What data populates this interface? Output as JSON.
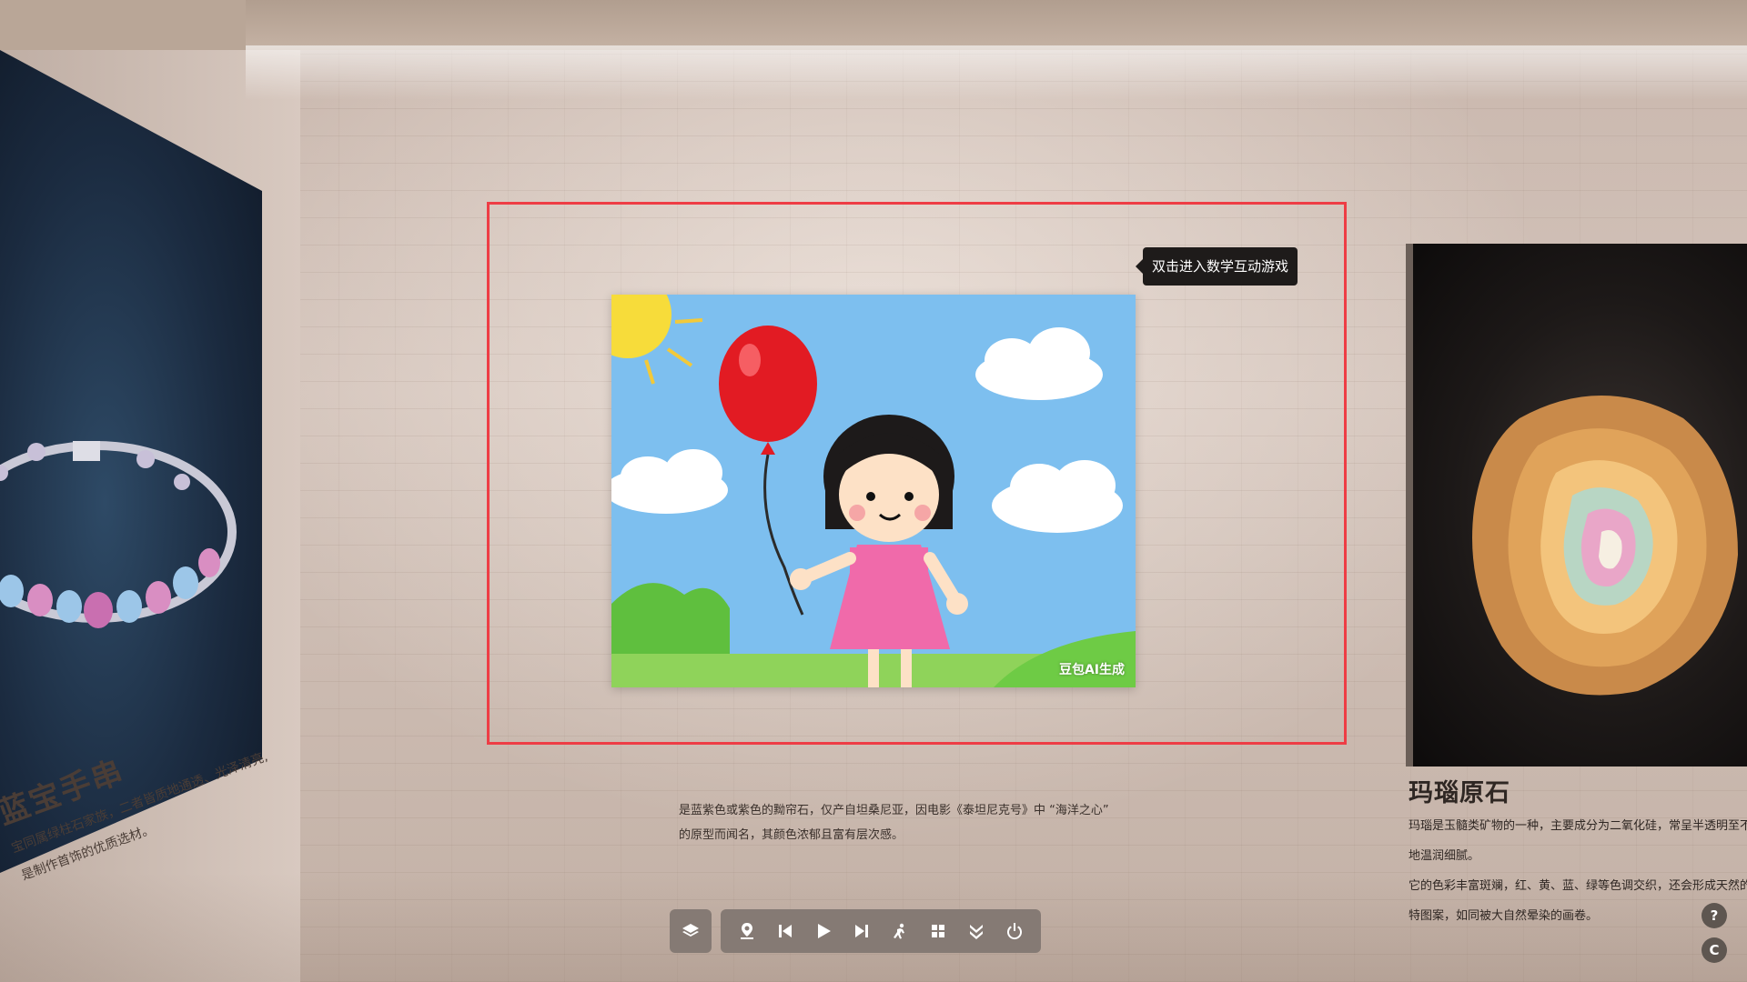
{
  "left_exhibit": {
    "title": "蓝宝手串",
    "desc_lines": [
      "宝同属绿柱石家族，二者皆质地通透、光泽清亮,",
      "是制作首饰的优质选材。"
    ]
  },
  "center_exhibit": {
    "tooltip": "双击进入数学互动游戏",
    "watermark": "豆包AI生成",
    "desc_lines": [
      "是蓝紫色或紫色的黝帘石，仅产自坦桑尼亚，因电影《泰坦尼克号》中 “海洋之心”",
      "的原型而闻名，其颜色浓郁且富有层次感。"
    ]
  },
  "right_exhibit": {
    "title": "玛瑙原石",
    "desc_lines": [
      "玛瑙是玉髓类矿物的一种，主要成分为二氧化硅，常呈半透明至不",
      "地温润细腻。",
      "它的色彩丰富斑斓，红、黄、蓝、绿等色调交织，还会形成天然的环",
      "特图案，如同被大自然晕染的画卷。"
    ]
  },
  "toolbar": {
    "layers": "layers-icon",
    "buttons": [
      "location-icon",
      "previous-icon",
      "play-icon",
      "next-icon",
      "auto-tour-icon",
      "grid-icon",
      "collapse-icon",
      "power-icon"
    ]
  },
  "side_buttons": {
    "help": "?",
    "c": "C"
  },
  "colors": {
    "highlight_border": "#ee3d45",
    "toolbar_bg": "#857a74",
    "tooltip_bg": "#1e1b1a"
  }
}
